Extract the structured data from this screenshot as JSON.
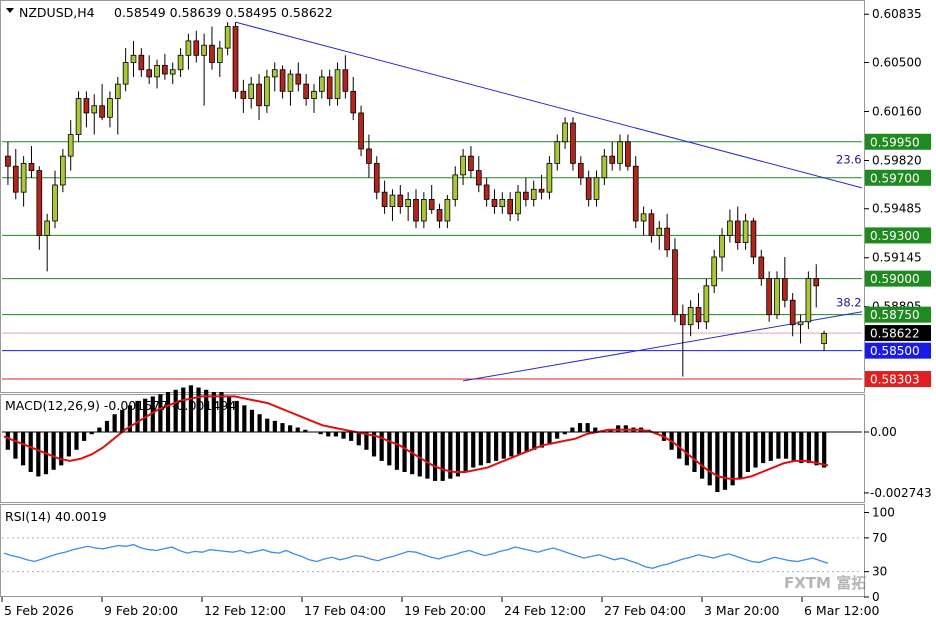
{
  "header": {
    "symbol_tf": "NZDUSD,H4",
    "ohlc": "0.58549 0.58639 0.58495 0.58622"
  },
  "colors": {
    "up_candle": "#a8c83a",
    "down_candle": "#b3261e",
    "candle_outline": "#000000",
    "hline_green": "#1f8a1f",
    "trend_blue": "#2a2ad4",
    "support_blue": "#1a1ae6",
    "resist_red": "#e02020",
    "macd_hist": "#000000",
    "macd_signal": "#e01010",
    "rsi_line": "#3c8cf0",
    "level_label_green_bg": "#1f8a1f",
    "level_label_blue_bg": "#1a1ae6",
    "level_label_red_bg": "#e02020",
    "current_price_bg": "#000000"
  },
  "price_axis": {
    "ticks": [
      "0.60835",
      "0.60500",
      "0.60160",
      "0.59820",
      "0.59485",
      "0.59145",
      "0.58805"
    ]
  },
  "level_labels": [
    {
      "text": "0.59950",
      "value": 0.5995,
      "style": "green"
    },
    {
      "text": "0.59700",
      "value": 0.597,
      "style": "green"
    },
    {
      "text": "0.59300",
      "value": 0.593,
      "style": "green"
    },
    {
      "text": "0.59000",
      "value": 0.59,
      "style": "green"
    },
    {
      "text": "0.58750",
      "value": 0.5875,
      "style": "green"
    },
    {
      "text": "0.58622",
      "value": 0.58622,
      "style": "current"
    },
    {
      "text": "0.58500",
      "value": 0.585,
      "style": "blue"
    },
    {
      "text": "0.58303",
      "value": 0.58303,
      "style": "red"
    }
  ],
  "fib_labels": [
    {
      "text": "23.6",
      "value": 0.5977
    },
    {
      "text": "38.2",
      "value": 0.5878
    }
  ],
  "macd": {
    "label": "MACD(12,26,9) -0.001577 -0.001494",
    "ticks": [
      "0.00",
      "-0.002743"
    ]
  },
  "rsi": {
    "label": "RSI(14) 40.0019",
    "ticks": [
      "100",
      "70",
      "30",
      "0"
    ]
  },
  "time_axis": {
    "labels": [
      "5 Feb 2026",
      "9 Feb 20:00",
      "12 Feb 12:00",
      "17 Feb 04:00",
      "19 Feb 20:00",
      "24 Feb 12:00",
      "27 Feb 04:00",
      "3 Mar 20:00",
      "6 Mar 12:00"
    ]
  },
  "watermark": "FXTM 富拓",
  "chart_data": {
    "type": "candlestick",
    "symbol": "NZDUSD",
    "timeframe": "H4",
    "last": {
      "open": 0.58549,
      "high": 0.58639,
      "low": 0.58495,
      "close": 0.58622
    },
    "ylim": [
      0.5822,
      0.6092
    ],
    "horizontal_levels": [
      0.5995,
      0.597,
      0.593,
      0.59,
      0.5875,
      0.585,
      0.58303
    ],
    "fibonacci": [
      {
        "level": "23.6",
        "price": 0.5977
      },
      {
        "level": "38.2",
        "price": 0.5878
      }
    ],
    "trendlines": [
      {
        "from": {
          "date": "12 Feb",
          "price": 0.6078
        },
        "to": {
          "date": "6 Mar",
          "price": 0.5963
        }
      },
      {
        "from": {
          "date": "19 Feb",
          "price": 0.5829
        },
        "to": {
          "date": "6 Mar",
          "price": 0.5877
        }
      }
    ],
    "candles": [
      [
        0.5985,
        0.5995,
        0.5965,
        0.5978
      ],
      [
        0.5978,
        0.599,
        0.5955,
        0.596
      ],
      [
        0.596,
        0.5985,
        0.595,
        0.598
      ],
      [
        0.598,
        0.5992,
        0.597,
        0.5975
      ],
      [
        0.5975,
        0.5978,
        0.592,
        0.593
      ],
      [
        0.593,
        0.5945,
        0.5905,
        0.594
      ],
      [
        0.594,
        0.5975,
        0.5935,
        0.5965
      ],
      [
        0.5965,
        0.599,
        0.596,
        0.5985
      ],
      [
        0.5985,
        0.601,
        0.5975,
        0.6
      ],
      [
        0.6,
        0.603,
        0.5995,
        0.6025
      ],
      [
        0.6025,
        0.603,
        0.6005,
        0.6015
      ],
      [
        0.6015,
        0.6028,
        0.6,
        0.602
      ],
      [
        0.602,
        0.6035,
        0.601,
        0.6012
      ],
      [
        0.6012,
        0.603,
        0.6005,
        0.6025
      ],
      [
        0.6025,
        0.604,
        0.6,
        0.6035
      ],
      [
        0.6035,
        0.606,
        0.603,
        0.605
      ],
      [
        0.605,
        0.6065,
        0.604,
        0.6055
      ],
      [
        0.6055,
        0.606,
        0.604,
        0.6045
      ],
      [
        0.6045,
        0.6055,
        0.6035,
        0.604
      ],
      [
        0.604,
        0.6052,
        0.6032,
        0.6048
      ],
      [
        0.6048,
        0.6056,
        0.6038,
        0.6042
      ],
      [
        0.6042,
        0.605,
        0.6035,
        0.6045
      ],
      [
        0.6045,
        0.606,
        0.604,
        0.6055
      ],
      [
        0.6055,
        0.607,
        0.6045,
        0.6065
      ],
      [
        0.6065,
        0.6072,
        0.605,
        0.6055
      ],
      [
        0.6055,
        0.607,
        0.602,
        0.6062
      ],
      [
        0.6062,
        0.6075,
        0.6045,
        0.605
      ],
      [
        0.605,
        0.6065,
        0.604,
        0.606
      ],
      [
        0.606,
        0.6078,
        0.6055,
        0.6075
      ],
      [
        0.6075,
        0.6078,
        0.6025,
        0.603
      ],
      [
        0.603,
        0.6038,
        0.6015,
        0.6025
      ],
      [
        0.6025,
        0.604,
        0.6018,
        0.6035
      ],
      [
        0.6035,
        0.6042,
        0.601,
        0.602
      ],
      [
        0.602,
        0.6045,
        0.6015,
        0.604
      ],
      [
        0.604,
        0.605,
        0.603,
        0.6045
      ],
      [
        0.6045,
        0.6048,
        0.6025,
        0.603
      ],
      [
        0.603,
        0.6045,
        0.602,
        0.6042
      ],
      [
        0.6042,
        0.605,
        0.603,
        0.6035
      ],
      [
        0.6035,
        0.6042,
        0.602,
        0.6025
      ],
      [
        0.6025,
        0.6035,
        0.6015,
        0.603
      ],
      [
        0.603,
        0.6045,
        0.6025,
        0.604
      ],
      [
        0.604,
        0.6045,
        0.602,
        0.6025
      ],
      [
        0.6025,
        0.605,
        0.602,
        0.6045
      ],
      [
        0.6045,
        0.6055,
        0.6025,
        0.603
      ],
      [
        0.603,
        0.604,
        0.601,
        0.6015
      ],
      [
        0.6015,
        0.602,
        0.5985,
        0.599
      ],
      [
        0.599,
        0.6,
        0.597,
        0.598
      ],
      [
        0.598,
        0.5985,
        0.5955,
        0.596
      ],
      [
        0.596,
        0.5968,
        0.5945,
        0.595
      ],
      [
        0.595,
        0.5962,
        0.594,
        0.5958
      ],
      [
        0.5958,
        0.5965,
        0.5945,
        0.595
      ],
      [
        0.595,
        0.596,
        0.594,
        0.5955
      ],
      [
        0.5955,
        0.5962,
        0.5935,
        0.594
      ],
      [
        0.594,
        0.596,
        0.5935,
        0.5955
      ],
      [
        0.5955,
        0.5965,
        0.5945,
        0.5948
      ],
      [
        0.5948,
        0.5952,
        0.5935,
        0.594
      ],
      [
        0.594,
        0.5958,
        0.5935,
        0.5955
      ],
      [
        0.5955,
        0.5978,
        0.595,
        0.5972
      ],
      [
        0.5972,
        0.599,
        0.5965,
        0.5985
      ],
      [
        0.5985,
        0.5992,
        0.597,
        0.5975
      ],
      [
        0.5975,
        0.5985,
        0.596,
        0.5965
      ],
      [
        0.5965,
        0.597,
        0.595,
        0.5955
      ],
      [
        0.5955,
        0.5962,
        0.5945,
        0.595
      ],
      [
        0.595,
        0.596,
        0.5945,
        0.5955
      ],
      [
        0.5955,
        0.596,
        0.594,
        0.5945
      ],
      [
        0.5945,
        0.5965,
        0.594,
        0.596
      ],
      [
        0.596,
        0.597,
        0.595,
        0.5955
      ],
      [
        0.5955,
        0.5968,
        0.595,
        0.5962
      ],
      [
        0.5962,
        0.5972,
        0.5955,
        0.596
      ],
      [
        0.596,
        0.5985,
        0.5955,
        0.598
      ],
      [
        0.598,
        0.6,
        0.5975,
        0.5995
      ],
      [
        0.5995,
        0.6012,
        0.599,
        0.6008
      ],
      [
        0.6008,
        0.6012,
        0.5975,
        0.598
      ],
      [
        0.598,
        0.5985,
        0.5965,
        0.597
      ],
      [
        0.597,
        0.5975,
        0.595,
        0.5955
      ],
      [
        0.5955,
        0.5975,
        0.595,
        0.597
      ],
      [
        0.597,
        0.599,
        0.5965,
        0.5985
      ],
      [
        0.5985,
        0.5995,
        0.5975,
        0.598
      ],
      [
        0.598,
        0.6,
        0.5975,
        0.5995
      ],
      [
        0.5995,
        0.6,
        0.5975,
        0.5978
      ],
      [
        0.5978,
        0.5985,
        0.5935,
        0.594
      ],
      [
        0.594,
        0.595,
        0.593,
        0.5945
      ],
      [
        0.5945,
        0.5948,
        0.5925,
        0.593
      ],
      [
        0.593,
        0.594,
        0.592,
        0.5935
      ],
      [
        0.5935,
        0.5945,
        0.5915,
        0.592
      ],
      [
        0.592,
        0.5928,
        0.587,
        0.5875
      ],
      [
        0.5875,
        0.5882,
        0.5832,
        0.5868
      ],
      [
        0.5868,
        0.5885,
        0.586,
        0.588
      ],
      [
        0.588,
        0.589,
        0.5865,
        0.587
      ],
      [
        0.587,
        0.59,
        0.5865,
        0.5895
      ],
      [
        0.5895,
        0.592,
        0.589,
        0.5915
      ],
      [
        0.5915,
        0.5935,
        0.5905,
        0.593
      ],
      [
        0.593,
        0.5948,
        0.5925,
        0.594
      ],
      [
        0.594,
        0.595,
        0.592,
        0.5925
      ],
      [
        0.5925,
        0.5945,
        0.592,
        0.594
      ],
      [
        0.594,
        0.5942,
        0.591,
        0.5915
      ],
      [
        0.5915,
        0.592,
        0.5895,
        0.59
      ],
      [
        0.59,
        0.5905,
        0.587,
        0.5875
      ],
      [
        0.5875,
        0.5905,
        0.5872,
        0.59
      ],
      [
        0.59,
        0.5915,
        0.588,
        0.5885
      ],
      [
        0.5885,
        0.589,
        0.586,
        0.5868
      ],
      [
        0.5868,
        0.5875,
        0.5855,
        0.587
      ],
      [
        0.587,
        0.5905,
        0.5865,
        0.59
      ],
      [
        0.59,
        0.591,
        0.588,
        0.5895
      ],
      [
        0.5855,
        0.5864,
        0.585,
        0.5862
      ]
    ],
    "macd_hist": [
      -0.0008,
      -0.0012,
      -0.0015,
      -0.0018,
      -0.002,
      -0.0019,
      -0.0017,
      -0.0015,
      -0.0011,
      -0.0008,
      -0.0004,
      -0.0001,
      0.0002,
      0.0005,
      0.0008,
      0.001,
      0.0012,
      0.0014,
      0.0015,
      0.0016,
      0.0017,
      0.0018,
      0.0019,
      0.002,
      0.0021,
      0.002,
      0.0019,
      0.0018,
      0.0018,
      0.0016,
      0.0014,
      0.0012,
      0.001,
      0.0008,
      0.0006,
      0.0005,
      0.0004,
      0.0003,
      0.0002,
      0.0001,
      0.0,
      -0.0001,
      -0.0002,
      -0.0002,
      -0.0003,
      -0.0004,
      -0.0006,
      -0.0008,
      -0.0011,
      -0.0013,
      -0.0015,
      -0.0017,
      -0.0018,
      -0.0019,
      -0.002,
      -0.0021,
      -0.0022,
      -0.0022,
      -0.0021,
      -0.002,
      -0.0018,
      -0.0016,
      -0.0015,
      -0.0014,
      -0.0013,
      -0.0012,
      -0.0011,
      -0.001,
      -0.0009,
      -0.0008,
      -0.0007,
      -0.0005,
      -0.0003,
      -0.0001,
      0.0002,
      0.0004,
      0.0004,
      0.0002,
      0.0,
      0.0001,
      0.0003,
      0.0003,
      0.0002,
      0.0002,
      0.0001,
      -0.0001,
      -0.0004,
      -0.0008,
      -0.0012,
      -0.0015,
      -0.0018,
      -0.0021,
      -0.0024,
      -0.0027,
      -0.0026,
      -0.0024,
      -0.0021,
      -0.0018,
      -0.0016,
      -0.0014,
      -0.0013,
      -0.0012,
      -0.0012,
      -0.0013,
      -0.0014,
      -0.0014,
      -0.0015,
      -0.0016
    ],
    "macd_signal": [
      -0.0002,
      -0.0004,
      -0.0006,
      -0.0008,
      -0.001,
      -0.0012,
      -0.0013,
      -0.0012,
      -0.001,
      -0.0007,
      -0.0003,
      0.0001,
      0.0004,
      0.0007,
      0.001,
      0.0012,
      0.0014,
      0.0015,
      0.0016,
      0.0016,
      0.0016,
      0.0016,
      0.0015,
      0.0014,
      0.0013,
      0.0011,
      0.0009,
      0.0007,
      0.0005,
      0.0003,
      0.0002,
      0.0001,
      0.0,
      -0.0001,
      -0.0002,
      -0.0004,
      -0.0006,
      -0.0009,
      -0.0012,
      -0.0015,
      -0.0017,
      -0.0018,
      -0.0018,
      -0.0017,
      -0.0016,
      -0.0014,
      -0.0012,
      -0.001,
      -0.0008,
      -0.0006,
      -0.0005,
      -0.0004,
      -0.0003,
      -0.0001,
      0.0,
      0.0001,
      0.0001,
      0.0001,
      0.0001,
      0.0,
      -0.0002,
      -0.0005,
      -0.0009,
      -0.0013,
      -0.0017,
      -0.002,
      -0.0021,
      -0.0021,
      -0.002,
      -0.0018,
      -0.0016,
      -0.0014,
      -0.0013,
      -0.0013,
      -0.0014,
      -0.0015
    ],
    "rsi": [
      52,
      49,
      47,
      44,
      42,
      45,
      48,
      51,
      53,
      56,
      58,
      60,
      58,
      57,
      59,
      61,
      60,
      62,
      58,
      56,
      55,
      57,
      59,
      55,
      52,
      54,
      53,
      56,
      55,
      54,
      53,
      55,
      52,
      54,
      56,
      53,
      52,
      55,
      51,
      48,
      44,
      42,
      45,
      47,
      44,
      46,
      49,
      48,
      45,
      43,
      46,
      48,
      51,
      54,
      53,
      50,
      47,
      45,
      48,
      50,
      53,
      55,
      52,
      49,
      51,
      54,
      56,
      59,
      57,
      55,
      53,
      56,
      58,
      55,
      52,
      49,
      46,
      48,
      50,
      47,
      44,
      46,
      43,
      40,
      36,
      34,
      37,
      39,
      42,
      45,
      47,
      50,
      48,
      46,
      49,
      51,
      48,
      45,
      42,
      41,
      44,
      47,
      45,
      43,
      42,
      44,
      46,
      43,
      40
    ]
  }
}
